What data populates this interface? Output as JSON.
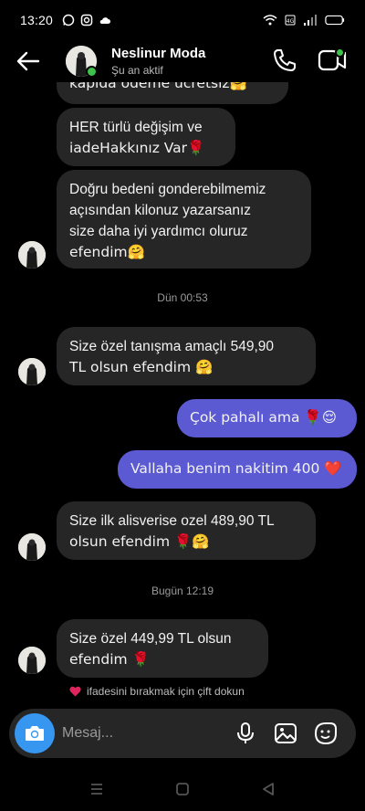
{
  "status_bar": {
    "time": "13:20"
  },
  "header": {
    "name": "Neslinur Moda",
    "status": "Şu an aktif"
  },
  "messages": {
    "m0": "kapıda ödeme ücretsiz🤗",
    "m1_line1": "HER türlü değişim ve",
    "m1_line2": "iadeHakkınız Var🌹",
    "m2_line1": "Doğru bedeni gonderebilmemiz",
    "m2_line2": "açısından kilonuz yazarsanız",
    "m2_line3": "size daha iyi yardımcı oluruz",
    "m2_line4": "efendim🤗",
    "ts1": "Dün 00:53",
    "m3_line1": "Size özel tanışma amaçlı 549,90",
    "m3_line2": "TL olsun efendim 🤗",
    "m4": "Çok pahalı ama 🌹😌",
    "m5": "Vallaha benim nakitim 400 ❤️",
    "m6_line1": "Size ilk alisverise ozel 489,90 TL",
    "m6_line2": "olsun efendim 🌹🤗",
    "ts2": "Bugün 12:19",
    "m7_line1": "Size özel 449,99 TL olsun",
    "m7_line2": "efendim 🌹",
    "hint": "ifadesini bırakmak için çift dokun"
  },
  "composer": {
    "placeholder": "Mesaj..."
  },
  "colors": {
    "incoming_bubble": "#262626",
    "outgoing_bubble": "#5b5ad3",
    "online_dot": "#3ec24a",
    "camera_button": "#3797f0"
  },
  "icons": [
    "back-arrow-icon",
    "phone-icon",
    "video-icon",
    "camera-icon",
    "mic-icon",
    "gallery-icon",
    "sticker-icon",
    "heart-icon"
  ]
}
